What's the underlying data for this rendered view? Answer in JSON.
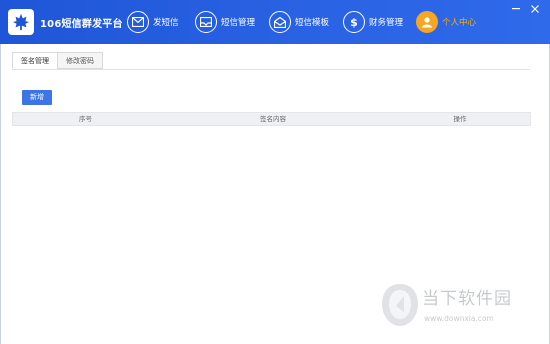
{
  "app": {
    "title": "106短信群发平台"
  },
  "nav": [
    {
      "label": "发短信",
      "icon": "mail-icon"
    },
    {
      "label": "短信管理",
      "icon": "envelope-icon"
    },
    {
      "label": "短信模板",
      "icon": "envelope-open-icon"
    },
    {
      "label": "财务管理",
      "icon": "dollar-icon"
    },
    {
      "label": "个人中心",
      "icon": "user-icon",
      "active": true
    }
  ],
  "tabs": [
    {
      "label": "签名管理",
      "active": true
    },
    {
      "label": "修改密码",
      "active": false
    }
  ],
  "toolbar": {
    "add_label": "新增"
  },
  "table": {
    "columns": [
      "序号",
      "签名内容",
      "操作"
    ],
    "rows": []
  },
  "watermark": {
    "title": "当下软件园",
    "url": "www.downxia.com"
  },
  "colors": {
    "header": "#2a63e4",
    "accent": "#3d75e6",
    "active_nav": "#f5a623"
  }
}
